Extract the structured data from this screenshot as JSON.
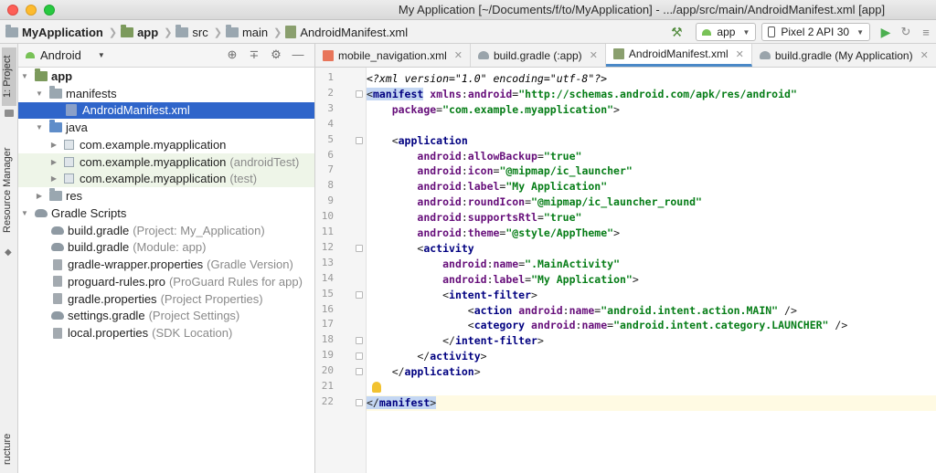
{
  "window": {
    "title": "My Application [~/Documents/f/to/MyApplication] - .../app/src/main/AndroidManifest.xml [app]"
  },
  "breadcrumbs": [
    "MyApplication",
    "app",
    "src",
    "main",
    "AndroidManifest.xml"
  ],
  "toolbar": {
    "run_config": "app",
    "device": "Pixel 2 API 30"
  },
  "side_tools": {
    "project": "1: Project",
    "resource_manager": "Resource Manager",
    "structure": "ructure"
  },
  "project_pane": {
    "view_selector": "Android",
    "tree": [
      {
        "label": "app",
        "hint": ""
      },
      {
        "label": "manifests",
        "hint": ""
      },
      {
        "label": "AndroidManifest.xml",
        "hint": ""
      },
      {
        "label": "java",
        "hint": ""
      },
      {
        "label": "com.example.myapplication",
        "hint": ""
      },
      {
        "label": "com.example.myapplication",
        "hint": "(androidTest)"
      },
      {
        "label": "com.example.myapplication",
        "hint": "(test)"
      },
      {
        "label": "res",
        "hint": ""
      },
      {
        "label": "Gradle Scripts",
        "hint": ""
      },
      {
        "label": "build.gradle",
        "hint": "(Project: My_Application)"
      },
      {
        "label": "build.gradle",
        "hint": "(Module: app)"
      },
      {
        "label": "gradle-wrapper.properties",
        "hint": "(Gradle Version)"
      },
      {
        "label": "proguard-rules.pro",
        "hint": "(ProGuard Rules for app)"
      },
      {
        "label": "gradle.properties",
        "hint": "(Project Properties)"
      },
      {
        "label": "settings.gradle",
        "hint": "(Project Settings)"
      },
      {
        "label": "local.properties",
        "hint": "(SDK Location)"
      }
    ]
  },
  "editor": {
    "tabs": [
      {
        "label": "mobile_navigation.xml",
        "active": false
      },
      {
        "label": "build.gradle (:app)",
        "active": false
      },
      {
        "label": "AndroidManifest.xml",
        "active": true
      },
      {
        "label": "build.gradle (My Application)",
        "active": false
      }
    ],
    "line_numbers": [
      "1",
      "2",
      "3",
      "4",
      "5",
      "6",
      "7",
      "8",
      "9",
      "10",
      "11",
      "12",
      "13",
      "14",
      "15",
      "16",
      "17",
      "18",
      "19",
      "20",
      "21",
      "22"
    ],
    "lines": [
      "<?xml version=\"1.0\" encoding=\"utf-8\"?>",
      "<manifest xmlns:android=\"http://schemas.android.com/apk/res/android\"",
      "    package=\"com.example.myapplication\">",
      "",
      "    <application",
      "        android:allowBackup=\"true\"",
      "        android:icon=\"@mipmap/ic_launcher\"",
      "        android:label=\"My Application\"",
      "        android:roundIcon=\"@mipmap/ic_launcher_round\"",
      "        android:supportsRtl=\"true\"",
      "        android:theme=\"@style/AppTheme\">",
      "        <activity",
      "            android:name=\".MainActivity\"",
      "            android:label=\"My Application\">",
      "            <intent-filter>",
      "                <action android:name=\"android.intent.action.MAIN\" />",
      "                <category android:name=\"android.intent.category.LAUNCHER\" />",
      "            </intent-filter>",
      "        </activity>",
      "    </application>",
      "",
      "</manifest>"
    ]
  }
}
